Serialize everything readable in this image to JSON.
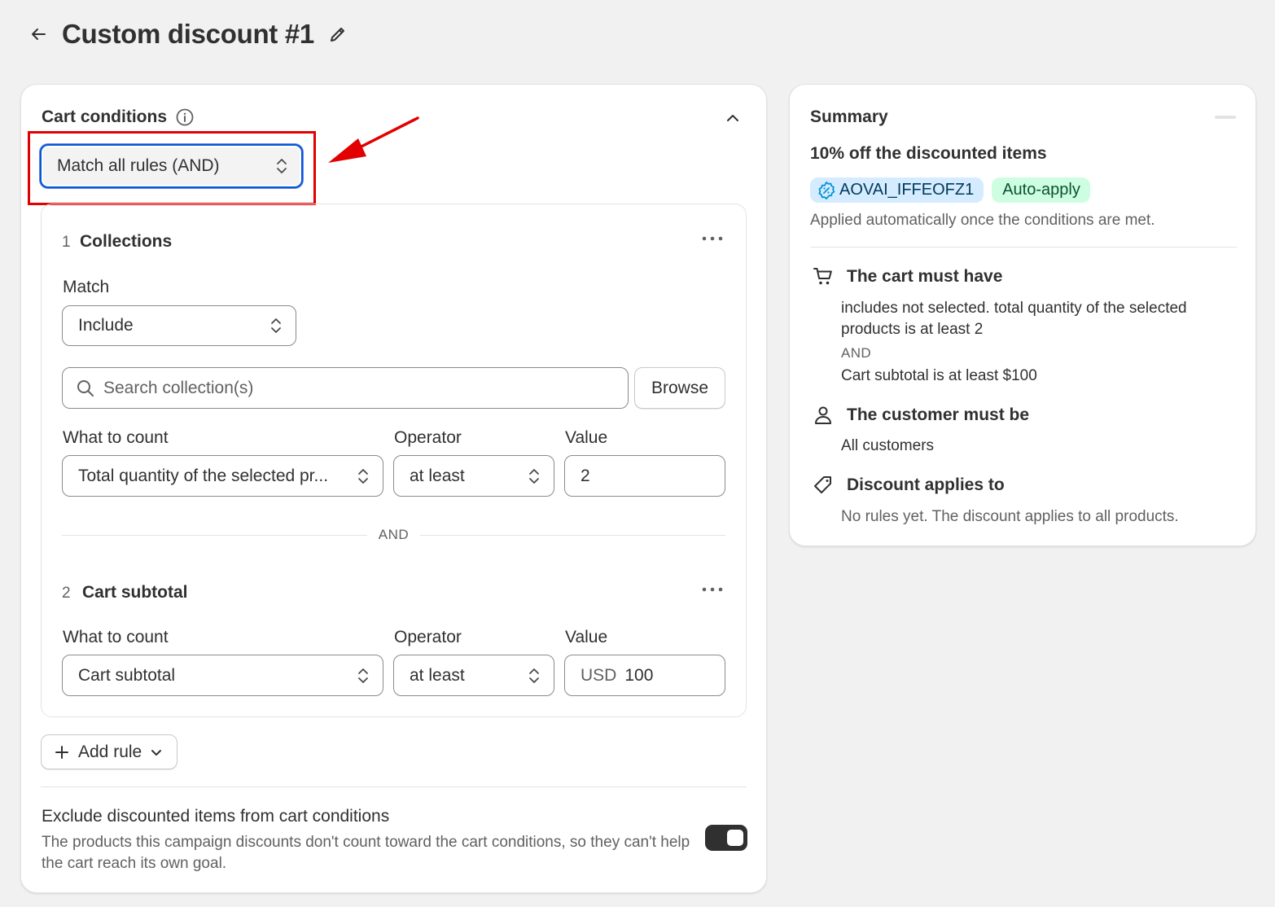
{
  "header": {
    "title": "Custom discount #1"
  },
  "cart_conditions": {
    "title": "Cart conditions",
    "match_mode": "Match all rules (AND)",
    "rules": [
      {
        "number": "1",
        "title": "Collections",
        "match_label": "Match",
        "match_value": "Include",
        "search_placeholder": "Search collection(s)",
        "browse_label": "Browse",
        "what_to_count_label": "What to count",
        "what_to_count_value": "Total quantity of the selected pr...",
        "operator_label": "Operator",
        "operator_value": "at least",
        "value_label": "Value",
        "value": "2"
      },
      {
        "number": "2",
        "title": "Cart subtotal",
        "what_to_count_label": "What to count",
        "what_to_count_value": "Cart subtotal",
        "operator_label": "Operator",
        "operator_value": "at least",
        "value_label": "Value",
        "currency": "USD",
        "value": "100"
      }
    ],
    "separator": "AND",
    "add_rule_label": "Add rule",
    "exclude_title": "Exclude discounted items from cart conditions",
    "exclude_desc": "The products this campaign discounts don't count toward the cart conditions, so they can't help the cart reach its own goal.",
    "exclude_enabled": true
  },
  "summary": {
    "title": "Summary",
    "subtitle": "10% off the discounted items",
    "code_badge": "AOVAI_IFFEOFZ1",
    "auto_badge": "Auto-apply",
    "note": "Applied automatically once the conditions are met.",
    "cart_heading": "The cart must have",
    "cart_text": "includes not selected. total quantity of the selected products is at least 2",
    "cart_and": "AND",
    "cart_text2": "Cart subtotal is at least $100",
    "customer_heading": "The customer must be",
    "customer_text": "All customers",
    "applies_heading": "Discount applies to",
    "applies_text": "No rules yet. The discount applies to all products."
  },
  "colors": {
    "focus": "#005bd3",
    "annotation": "#e20000",
    "badge_code_bg": "#d5ebff",
    "badge_auto_bg": "#cdfee1"
  },
  "icons": [
    "back-arrow-icon",
    "pencil-icon",
    "info-icon",
    "chevron-up-icon",
    "select-chevron-icon",
    "more-icon",
    "search-icon",
    "plus-icon",
    "chevron-down-icon",
    "discount-icon",
    "cart-icon",
    "person-icon",
    "tag-icon"
  ]
}
